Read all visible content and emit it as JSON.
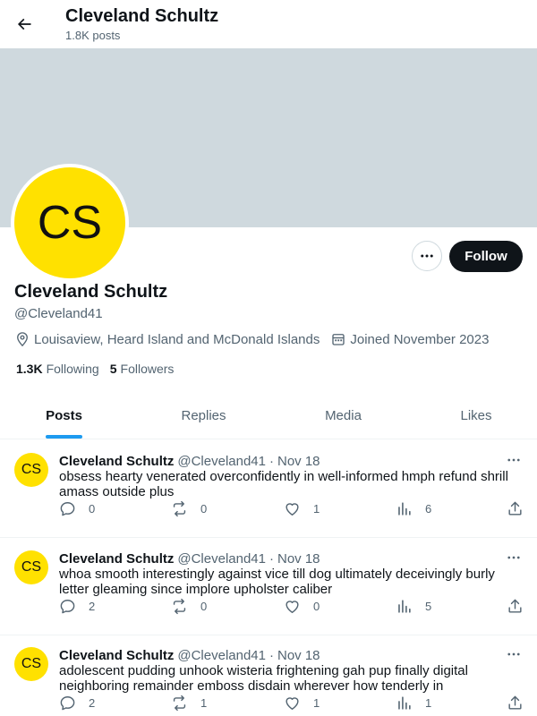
{
  "header": {
    "title": "Cleveland Schultz",
    "post_count": "1.8K posts"
  },
  "profile": {
    "avatar_initials": "CS",
    "name": "Cleveland Schultz",
    "handle": "@Cleveland41",
    "location": "Louisaview, Heard Island and McDonald Islands",
    "joined": "Joined November 2023",
    "following_count": "1.3K",
    "following_label": "Following",
    "followers_count": "5",
    "followers_label": "Followers",
    "follow_label": "Follow"
  },
  "icons": {
    "back": "arrow-left-icon",
    "more": "ellipsis-icon",
    "location": "map-pin-icon",
    "calendar": "calendar-icon",
    "reply": "speech-bubble-icon",
    "repost": "repost-icon",
    "like": "heart-icon",
    "views": "bar-chart-icon",
    "share": "share-icon"
  },
  "colors": {
    "avatar": "#ffe100",
    "banner": "#cfd9de",
    "accent": "#1d9bf0",
    "follow_button": "#0f1419"
  },
  "tabs": [
    {
      "label": "Posts",
      "active": true
    },
    {
      "label": "Replies",
      "active": false
    },
    {
      "label": "Media",
      "active": false
    },
    {
      "label": "Likes",
      "active": false
    }
  ],
  "posts": [
    {
      "avatar_initials": "CS",
      "author": "Cleveland Schultz",
      "handle": "@Cleveland41",
      "separator": "·",
      "date": "Nov 18",
      "text": "obsess hearty venerated overconfidently in well-informed hmph refund shrill amass outside plus",
      "replies": "0",
      "reposts": "0",
      "likes": "1",
      "views": "6"
    },
    {
      "avatar_initials": "CS",
      "author": "Cleveland Schultz",
      "handle": "@Cleveland41",
      "separator": "·",
      "date": "Nov 18",
      "text": "whoa smooth interestingly against vice till dog ultimately deceivingly burly letter gleaming since implore upholster caliber",
      "replies": "2",
      "reposts": "0",
      "likes": "0",
      "views": "5"
    },
    {
      "avatar_initials": "CS",
      "author": "Cleveland Schultz",
      "handle": "@Cleveland41",
      "separator": "·",
      "date": "Nov 18",
      "text": "adolescent pudding unhook wisteria frightening gah pup finally digital neighboring remainder emboss disdain wherever how tenderly in",
      "replies": "2",
      "reposts": "1",
      "likes": "1",
      "views": "1"
    }
  ]
}
